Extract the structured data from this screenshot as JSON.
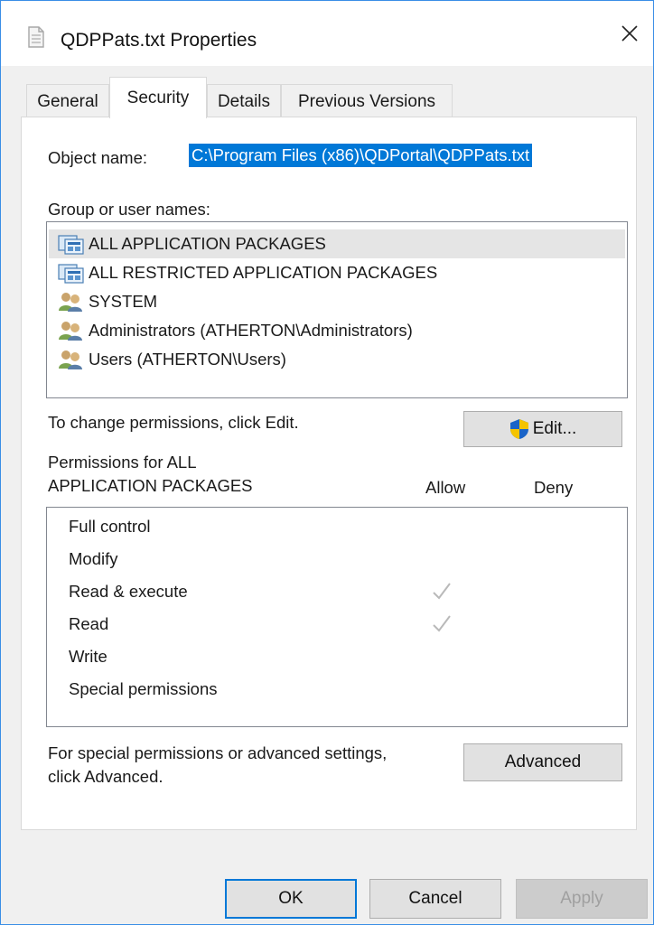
{
  "window": {
    "title": "QDPPats.txt Properties",
    "accent_color": "#0078d7"
  },
  "tabs": [
    {
      "label": "General",
      "active": false
    },
    {
      "label": "Security",
      "active": true
    },
    {
      "label": "Details",
      "active": false
    },
    {
      "label": "Previous Versions",
      "active": false
    }
  ],
  "security": {
    "object_name_label": "Object name:",
    "object_name_value": "C:\\Program Files (x86)\\QDPortal\\QDPPats.txt",
    "group_label": "Group or user names:",
    "users": [
      {
        "name": "ALL APPLICATION PACKAGES",
        "icon": "app-packages-icon",
        "selected": true
      },
      {
        "name": "ALL RESTRICTED APPLICATION PACKAGES",
        "icon": "app-packages-icon",
        "selected": false
      },
      {
        "name": "SYSTEM",
        "icon": "user-group-icon",
        "selected": false
      },
      {
        "name": "Administrators (ATHERTON\\Administrators)",
        "icon": "user-group-icon",
        "selected": false
      },
      {
        "name": "Users (ATHERTON\\Users)",
        "icon": "user-group-icon",
        "selected": false
      }
    ],
    "change_hint": "To change permissions, click Edit.",
    "edit_button": "Edit...",
    "permissions_for_line1": "Permissions for ALL",
    "permissions_for_line2": "APPLICATION PACKAGES",
    "allow_header": "Allow",
    "deny_header": "Deny",
    "permissions": [
      {
        "name": "Full control",
        "allow": false,
        "deny": false
      },
      {
        "name": "Modify",
        "allow": false,
        "deny": false
      },
      {
        "name": "Read & execute",
        "allow": true,
        "deny": false
      },
      {
        "name": "Read",
        "allow": true,
        "deny": false
      },
      {
        "name": "Write",
        "allow": false,
        "deny": false
      },
      {
        "name": "Special permissions",
        "allow": false,
        "deny": false
      }
    ],
    "advanced_hint_line1": "For special permissions or advanced settings,",
    "advanced_hint_line2": "click Advanced.",
    "advanced_button": "Advanced"
  },
  "footer": {
    "ok": "OK",
    "cancel": "Cancel",
    "apply": "Apply"
  }
}
